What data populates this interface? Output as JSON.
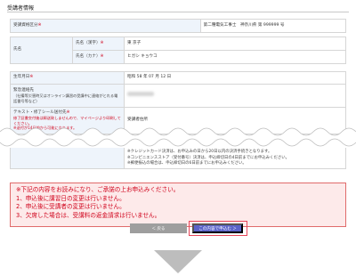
{
  "section": {
    "title": "受講者情報"
  },
  "required_mark": "※",
  "rows": [
    {
      "label": "受講資格区分",
      "value": "第二種電気工事士　神奈川県 第 999999 号"
    },
    {
      "label": "氏名",
      "sub_label": "氏名（漢字）",
      "value": "東 京子"
    },
    {
      "label": "",
      "sub_label": "氏名（カナ）",
      "value": "ヒガシ キョウコ"
    },
    {
      "label": "生年月日",
      "value": "昭和 58 年 07 月 12 日"
    },
    {
      "label": "緊急連絡先",
      "label_note": "（社備等災害時又はオンライン講習の受講中に連絡がとれる電話番号等など）",
      "value": ""
    },
    {
      "label": "テキスト・修了シール送付先",
      "label_note": "修了証書交付後は郵送致しませんので、マイページより印刷してください。",
      "label_note2": "※送付が14日前から可能になります。",
      "value": "受講者住所"
    }
  ],
  "lower": {
    "lines": [
      "※クレジットカード決済は、お申込みの日から20日以内の決済手続きとなります。",
      "※コンビニエンスストア（受付番号）決済は、申込締切日の4日前までにお申込みください。",
      "※郵便振込の場合は、申込締切日の6日前までにお申込みください。"
    ]
  },
  "notice": {
    "lines": [
      "※下記の内容をお読みになり、ご承諾の上お申込みください。",
      "1、申込後に講習日の変更は行いません。",
      "2、申込後に受講者の変更は行いません。",
      "3、欠席した場合は、受講料の返金請求は行いません。"
    ]
  },
  "buttons": {
    "back": "＜ 戻る",
    "apply": "この内容で申込む ＞"
  },
  "colors": {
    "label_bg": "#eef4fb",
    "required": "#d0021b",
    "notice_bg": "#fdeaea",
    "apply_bg": "#5b63c9",
    "back_bg": "#9e9e9e",
    "highlight": "#e8475a"
  }
}
